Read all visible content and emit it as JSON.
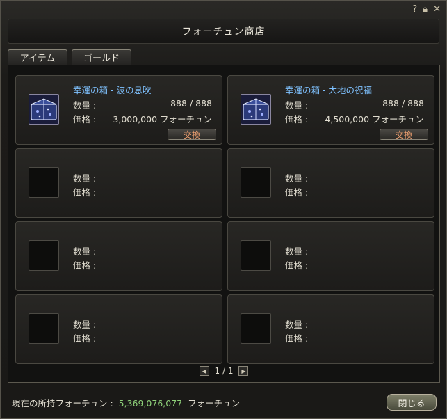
{
  "window": {
    "title": "フォーチュン商店",
    "icons": [
      "help-icon",
      "lock-icon",
      "close-icon"
    ]
  },
  "tabs": [
    {
      "label": "アイテム"
    },
    {
      "label": "ゴールド"
    }
  ],
  "slots": [
    {
      "name": "幸運の箱 - 波の息吹",
      "qty_label": "数量 :",
      "qty": "888 / 888",
      "price_label": "価格 :",
      "price": "3,000,000 フォーチュン",
      "button": "交換",
      "icon": "lucky-box-icon"
    },
    {
      "name": "幸運の箱 - 大地の祝福",
      "qty_label": "数量 :",
      "qty": "888 / 888",
      "price_label": "価格 :",
      "price": "4,500,000 フォーチュン",
      "button": "交換",
      "icon": "lucky-box-icon"
    },
    {
      "qty_label": "数量 :",
      "price_label": "価格 :"
    },
    {
      "qty_label": "数量 :",
      "price_label": "価格 :"
    },
    {
      "qty_label": "数量 :",
      "price_label": "価格 :"
    },
    {
      "qty_label": "数量 :",
      "price_label": "価格 :"
    },
    {
      "qty_label": "数量 :",
      "price_label": "価格 :"
    },
    {
      "qty_label": "数量 :",
      "price_label": "価格 :"
    }
  ],
  "pager": {
    "text": "1 / 1"
  },
  "footer": {
    "label": "現在の所持フォーチュン :",
    "amount": "5,369,076,077",
    "unit": "フォーチュン"
  },
  "close_button": "閉じる"
}
